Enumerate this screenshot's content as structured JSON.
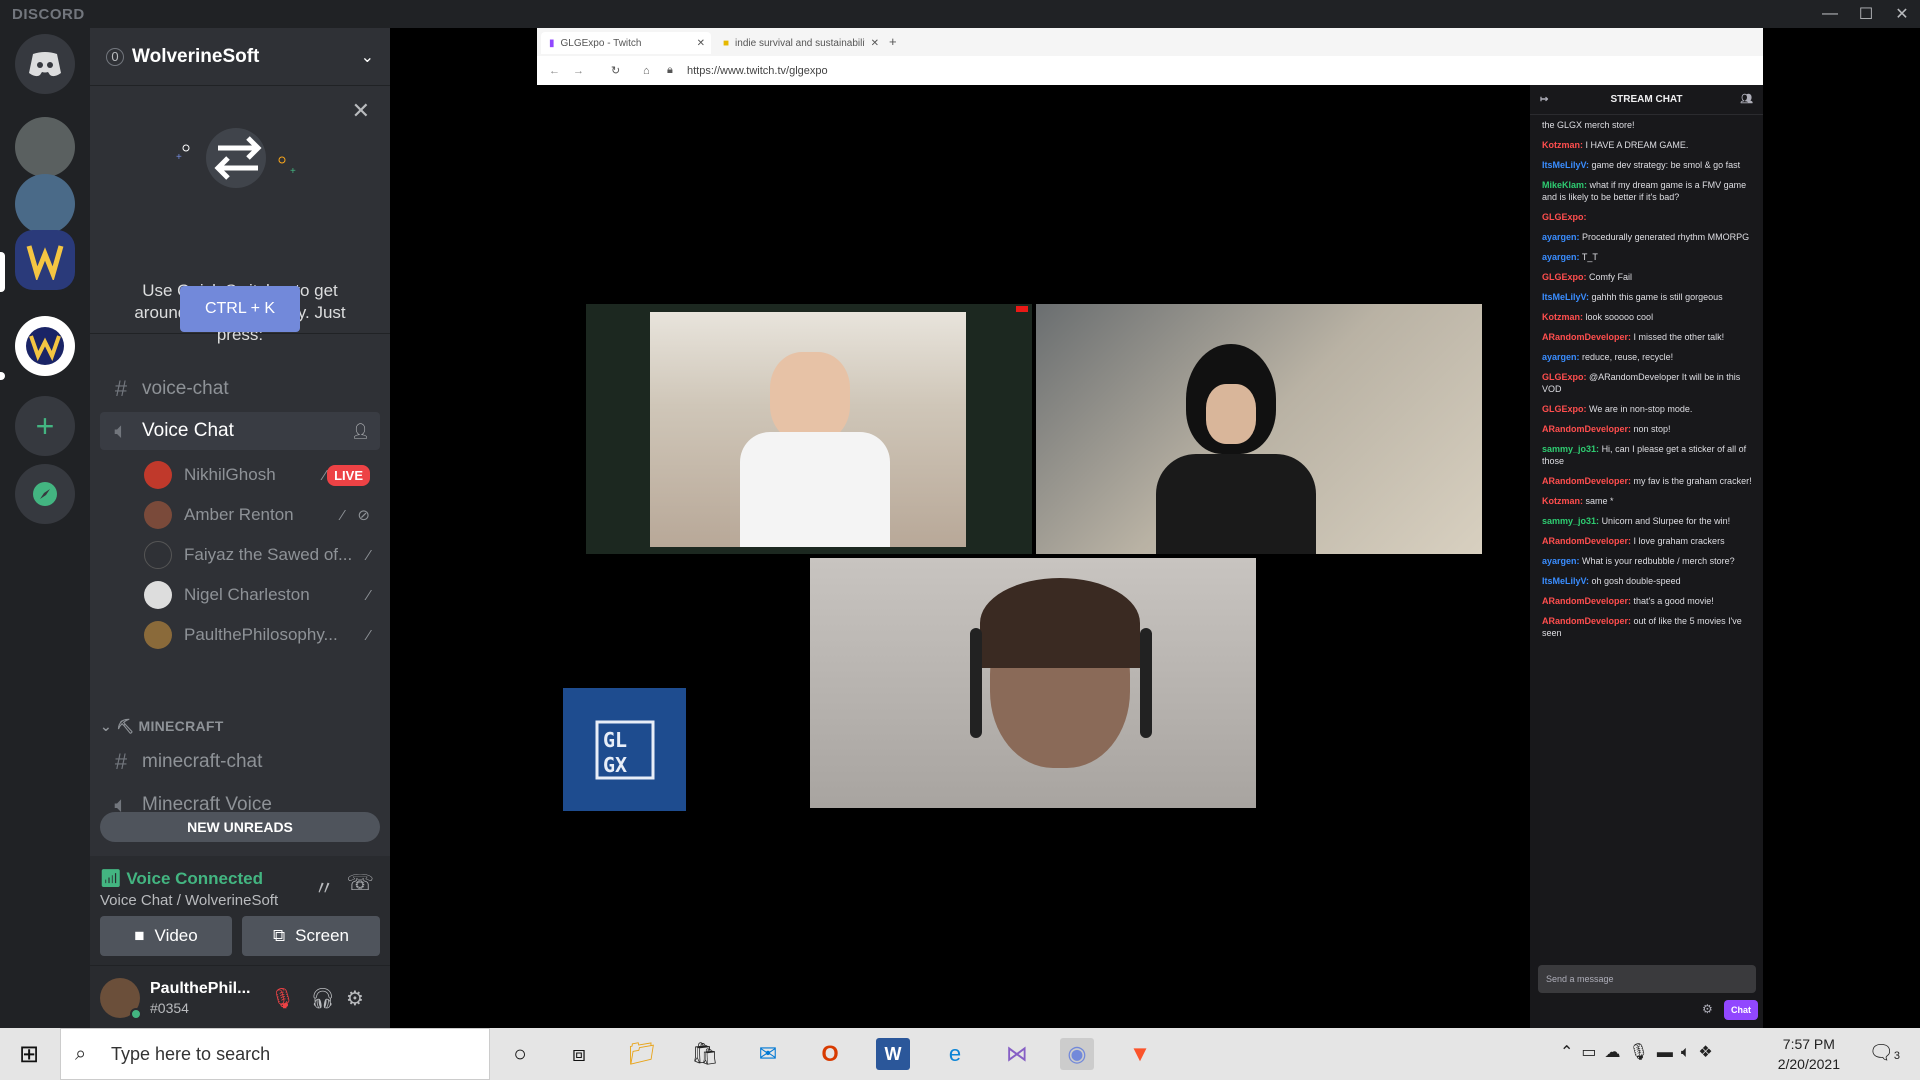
{
  "app": {
    "brand": "DISCORD"
  },
  "server": {
    "name": "WolverineSoft",
    "badge": "0"
  },
  "quick_switcher": {
    "text": "Use Quick Switcher to get around Discord quickly. Just press:",
    "shortcut": "CTRL + K"
  },
  "channels": {
    "voice_chat_text": "voice-chat",
    "voice_chat": "Voice Chat",
    "voice_users": [
      {
        "name": "NikhilGhosh",
        "live": "LIVE"
      },
      {
        "name": "Amber Renton"
      },
      {
        "name": "Faiyaz the Sawed of..."
      },
      {
        "name": "Nigel Charleston"
      },
      {
        "name": "PaulthePhilosophy..."
      }
    ],
    "category": "MINECRAFT",
    "minecraft_chat": "minecraft-chat",
    "minecraft_voice": "Minecraft Voice",
    "new_unreads": "NEW UNREADS"
  },
  "voice_panel": {
    "status": "Voice Connected",
    "sub": "Voice Chat / WolverineSoft",
    "video": "Video",
    "screen": "Screen"
  },
  "user": {
    "name": "PaulthePhil...",
    "tag": "#0354"
  },
  "browser": {
    "tab1": "GLGExpo - Twitch",
    "tab2": "indie survival and sustainability ...",
    "url": "https://www.twitch.tv/glgexpo"
  },
  "stream_chat": {
    "header": "STREAM CHAT",
    "messages": [
      {
        "user": "",
        "text": "the GLGX merch store!"
      },
      {
        "user": "Kotzman:",
        "text": "I HAVE A DREAM GAME."
      },
      {
        "user": "ItsMeLilyV:",
        "text": "game dev strategy: be smol & go fast"
      },
      {
        "user": "MikeKlam:",
        "text": "what if my dream game is a FMV game and is likely to be better if it's bad?"
      },
      {
        "user": "GLGExpo:",
        "text": ""
      },
      {
        "user": "ayargen:",
        "text": "Procedurally generated rhythm MMORPG"
      },
      {
        "user": "ayargen:",
        "text": "T_T"
      },
      {
        "user": "GLGExpo:",
        "text": "Comfy Fail"
      },
      {
        "user": "ItsMeLilyV:",
        "text": "gahhh this game is still gorgeous"
      },
      {
        "user": "Kotzman:",
        "text": "look sooooo cool"
      },
      {
        "user": "ARandomDeveloper:",
        "text": "I missed the other talk!"
      },
      {
        "user": "ayargen:",
        "text": "reduce, reuse, recycle!"
      },
      {
        "user": "GLGExpo:",
        "text": "@ARandomDeveloper It will be in this VOD"
      },
      {
        "user": "GLGExpo:",
        "text": "We are in non-stop mode."
      },
      {
        "user": "ARandomDeveloper:",
        "text": "non stop!"
      },
      {
        "user": "sammy_jo31:",
        "text": "Hi, can I please get a sticker of all of those"
      },
      {
        "user": "ARandomDeveloper:",
        "text": "my fav is the graham cracker!"
      },
      {
        "user": "Kotzman:",
        "text": "same *"
      },
      {
        "user": "sammy_jo31:",
        "text": "Unicorn and Slurpee for the win!"
      },
      {
        "user": "ARandomDeveloper:",
        "text": "I love graham crackers"
      },
      {
        "user": "ayargen:",
        "text": "What is your redbubble / merch store?"
      },
      {
        "user": "ItsMeLilyV:",
        "text": "oh gosh double-speed"
      },
      {
        "user": "ARandomDeveloper:",
        "text": "that's a good movie!"
      },
      {
        "user": "ARandomDeveloper:",
        "text": "out of like the 5 movies I've seen"
      }
    ],
    "input_placeholder": "Send a message",
    "chat_button": "Chat"
  },
  "taskbar": {
    "search_placeholder": "Type here to search",
    "time": "7:57 PM",
    "date": "2/20/2021",
    "notifications": "3"
  }
}
